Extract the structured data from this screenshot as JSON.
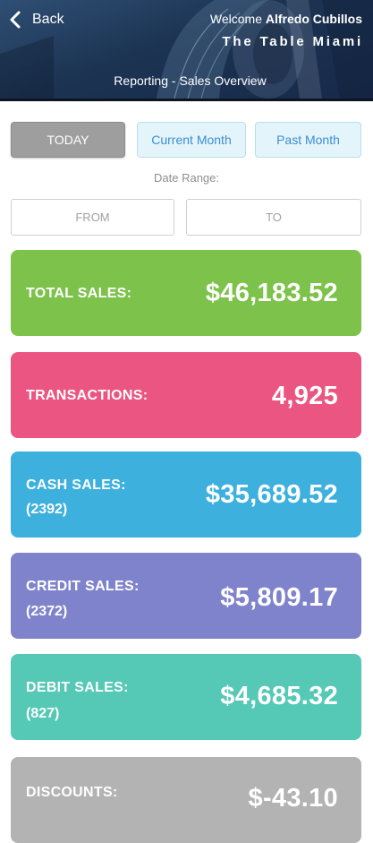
{
  "header": {
    "back_label": "Back",
    "welcome_prefix": "Welcome",
    "user_name": "Alfredo Cubillos",
    "venue": "The Table Miami",
    "subtitle": "Reporting - Sales Overview"
  },
  "period_buttons": {
    "today": "TODAY",
    "current_month": "Current Month",
    "past_month": "Past Month",
    "selected": "TODAY"
  },
  "date_range": {
    "label": "Date Range:",
    "from_placeholder": "FROM",
    "to_placeholder": "TO"
  },
  "cards": {
    "total_sales": {
      "label": "TOTAL SALES:",
      "value": "$46,183.52",
      "color": "#7dc24b"
    },
    "transactions": {
      "label": "TRANSACTIONS:",
      "value": "4,925",
      "color": "#eb5582"
    },
    "cash_sales": {
      "label": "CASH SALES:",
      "count": "(2392)",
      "value": "$35,689.52",
      "color": "#3db0de"
    },
    "credit_sales": {
      "label": "CREDIT SALES:",
      "count": "(2372)",
      "value": "$5,809.17",
      "color": "#7f83cb"
    },
    "debit_sales": {
      "label": "DEBIT SALES:",
      "count": "(827)",
      "value": "$4,685.32",
      "color": "#55c8b6"
    },
    "discounts": {
      "label": "DISCOUNTS:",
      "value": "$-43.10",
      "color": "#b3b3b3"
    }
  },
  "colors": {
    "header_bg": "#1c3352",
    "active_button": "#9e9e9e",
    "inactive_button_bg": "#e4f4fb",
    "inactive_button_text": "#3b8fd1"
  }
}
